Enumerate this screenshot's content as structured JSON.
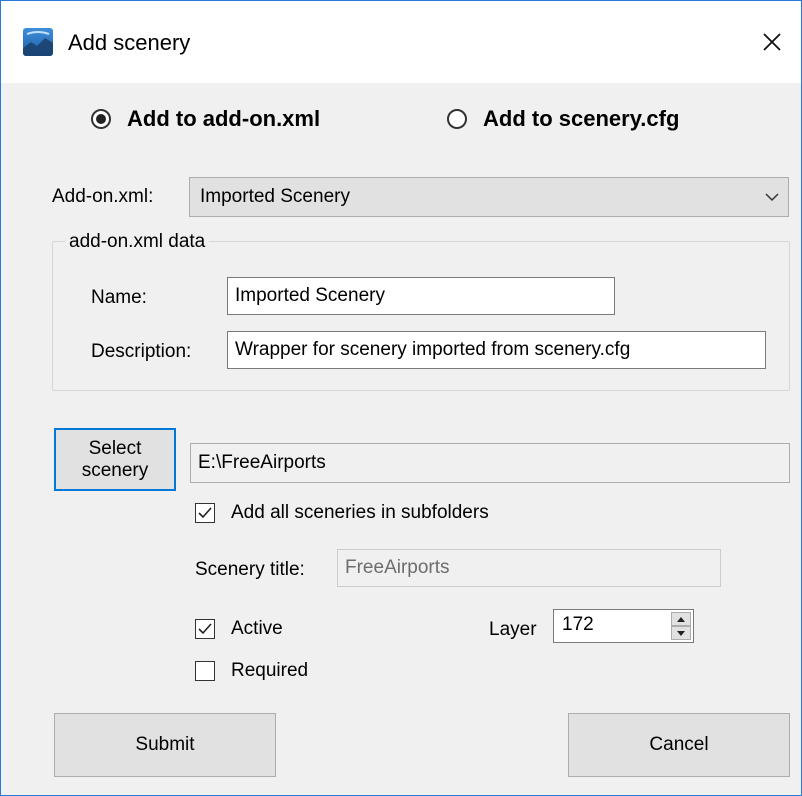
{
  "window": {
    "title": "Add scenery",
    "close_glyph": "✕"
  },
  "target": {
    "options": [
      {
        "label": "Add to add-on.xml",
        "checked": true
      },
      {
        "label": "Add to scenery.cfg",
        "checked": false
      }
    ]
  },
  "addon_select": {
    "label": "Add-on.xml:",
    "value": "Imported Scenery"
  },
  "addon_data": {
    "group_label": "add-on.xml data",
    "name_label": "Name:",
    "name_value": "Imported Scenery",
    "description_label": "Description:",
    "description_value": "Wrapper for scenery imported from scenery.cfg"
  },
  "scenery": {
    "select_button_line1": "Select",
    "select_button_line2": "scenery",
    "path_value": "E:\\FreeAirports",
    "subfolders_label": "Add all sceneries in subfolders",
    "subfolders_checked": true,
    "title_label": "Scenery title:",
    "title_value": "FreeAirports",
    "active_label": "Active",
    "active_checked": true,
    "required_label": "Required",
    "required_checked": false,
    "layer_label": "Layer",
    "layer_value": "172"
  },
  "actions": {
    "submit_label": "Submit",
    "cancel_label": "Cancel"
  },
  "icons": {
    "app": "app-scenery-icon",
    "close": "close-icon",
    "dropdown": "chevron-down-icon",
    "check": "checkmark-icon",
    "spin_up": "triangle-up-icon",
    "spin_down": "triangle-down-icon"
  },
  "colors": {
    "focus_border": "#0078d7",
    "window_border": "#2b79d6",
    "button_face": "#e1e1e1",
    "dialog_bg": "#f0f0f0"
  }
}
